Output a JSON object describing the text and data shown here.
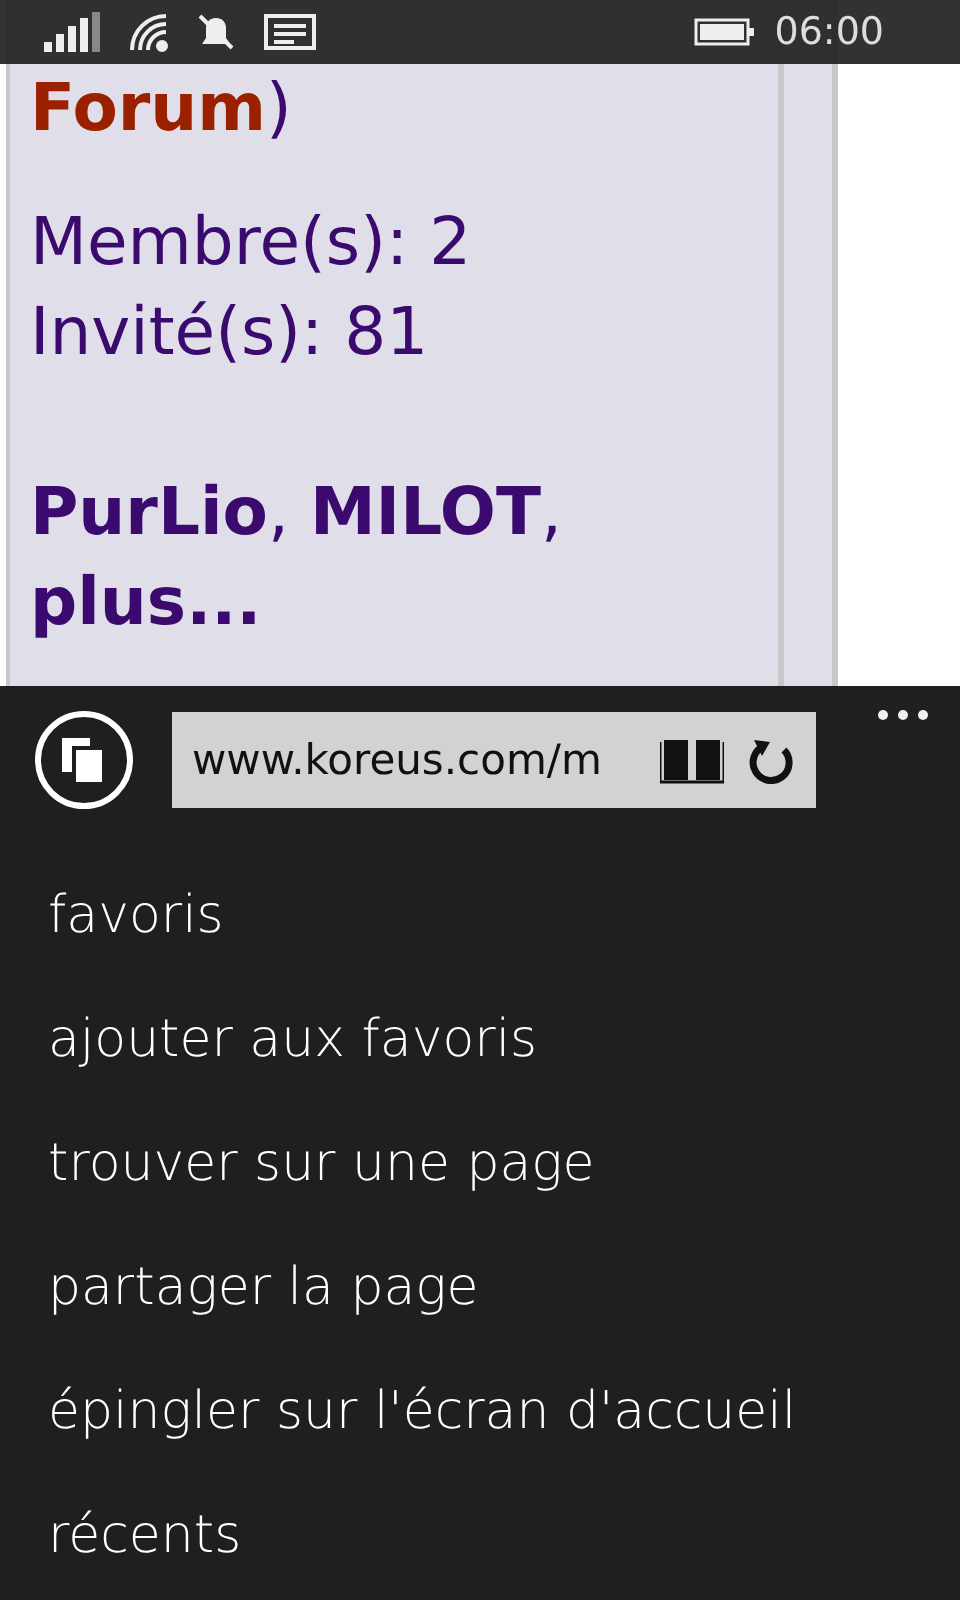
{
  "status_bar": {
    "time": "06:00"
  },
  "page": {
    "forum_link": "Forum",
    "forum_rest": ")",
    "members": "Membre(s): 2",
    "guests": "Invité(s): 81",
    "online": "**PurLio**, **MILOT**, **plus...**"
  },
  "app_bar": {
    "address": "www.koreus.com/m",
    "menu_items": [
      "favoris",
      "ajouter aux favoris",
      "trouver sur une page",
      "partager la page",
      "épingler sur l'écran d'accueil",
      "récents"
    ]
  }
}
